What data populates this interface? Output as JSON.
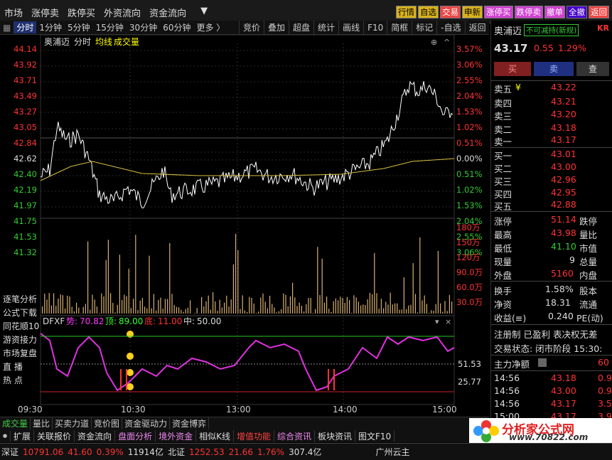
{
  "top": {
    "menus": [
      "市场",
      "涨停卖",
      "跌停买",
      "外资流向",
      "资金流向"
    ],
    "buttons": [
      "行情",
      "自选",
      "交易",
      "申新",
      "涨停买",
      "跌停卖",
      "撤单",
      "全撤",
      "返回"
    ]
  },
  "tabs": [
    "分时",
    "1分钟",
    "5分钟",
    "15分钟",
    "30分钟",
    "60分钟",
    "更多 〉"
  ],
  "tools": [
    "竞价",
    "叠加",
    "超盘",
    "统计",
    "画线",
    "F10",
    "简框",
    "标记",
    "-自选",
    "返回"
  ],
  "chart": {
    "stock_name": "奥浦迈",
    "labels": [
      "分时",
      "均线",
      "成交量"
    ],
    "left_prices": [
      "44.14",
      "43.92",
      "43.71",
      "43.49",
      "43.27",
      "43.05",
      "42.84",
      "42.62",
      "42.40",
      "42.19",
      "41.97",
      "41.75",
      "41.53",
      "41.32"
    ],
    "right_pcts": [
      "3.57%",
      "3.06%",
      "2.55%",
      "2.04%",
      "1.53%",
      "1.02%",
      "0.51%",
      "0.00%",
      "0.51%",
      "1.02%",
      "1.53%",
      "2.04%",
      "2.55%",
      "3.06%"
    ],
    "vol_labels": [
      "180万",
      "150万",
      "120万",
      "90.0万",
      "60.0万",
      "30.0万"
    ],
    "dfxf": {
      "name": "DFXF",
      "shi_label": "势:",
      "shi": "70.82",
      "ding_label": "顶:",
      "ding": "89.00",
      "di_label": "底:",
      "di": "11.00",
      "zhong_label": "中:",
      "zhong": "50.00"
    },
    "dfxf_levels": [
      "51.53",
      "25.77"
    ],
    "times": [
      "09:30",
      "10:30",
      "13:00",
      "14:00",
      "15:00"
    ]
  },
  "chart_data": {
    "type": "line",
    "x": [
      "09:30",
      "10:30",
      "13:00",
      "14:00",
      "15:00"
    ],
    "ylim": [
      41.32,
      44.14
    ],
    "series": []
  },
  "side": [
    "逐笔分析",
    "公式下载",
    "同花顺10",
    "游资接力",
    "市场复盘",
    "直  播",
    "热  点"
  ],
  "bottomtabs": [
    "成交量",
    "量比",
    "买卖力道",
    "竞价图",
    "资金驱动力",
    "资金博弈"
  ],
  "bar2": [
    "扩展",
    "关联报价",
    "资金流向",
    "盘面分析",
    "境外资金",
    "相似K线",
    "增值功能",
    "综合资讯",
    "板块资讯",
    "图文F10"
  ],
  "status": {
    "sz_label": "深证",
    "sz_val": "10791.06",
    "sz_chg": "41.60",
    "sz_pct": "0.39%",
    "sz_amt": "11914亿",
    "bz_label": "北证",
    "bz_val": "1252.53",
    "bz_chg": "21.66",
    "bz_pct": "1.76%",
    "bz_amt": "307.4亿",
    "right": "广州云主"
  },
  "right": {
    "name": "奥浦迈",
    "tag": "不可减持(新规)",
    "kr": "KR",
    "price": "43.17",
    "chg": "0.55",
    "pct": "1.29%",
    "buy_btn": "买",
    "sell_btn": "卖",
    "query_btn": "查",
    "asks": [
      {
        "k": "卖五",
        "v": "43.22"
      },
      {
        "k": "卖四",
        "v": "43.21"
      },
      {
        "k": "卖三",
        "v": "43.20"
      },
      {
        "k": "卖二",
        "v": "43.18"
      },
      {
        "k": "卖一",
        "v": "43.17"
      }
    ],
    "bids": [
      {
        "k": "买一",
        "v": "43.01"
      },
      {
        "k": "买二",
        "v": "43.00"
      },
      {
        "k": "买三",
        "v": "42.96"
      },
      {
        "k": "买四",
        "v": "42.95"
      },
      {
        "k": "买五",
        "v": "42.88"
      }
    ],
    "ask_mark": "¥",
    "stats": [
      {
        "k": "涨停",
        "v": "51.14",
        "k2": "跌停"
      },
      {
        "k": "最高",
        "v": "43.98",
        "k2": "量比"
      },
      {
        "k": "最低",
        "v": "41.10",
        "k2": "市值"
      },
      {
        "k": "现量",
        "v": "9",
        "k2": "总量"
      },
      {
        "k": "外盘",
        "v": "5160",
        "k2": "内盘"
      }
    ],
    "stats2": [
      {
        "k": "换手",
        "v": "1.58%",
        "k2": "股本"
      },
      {
        "k": "净资",
        "v": "18.31",
        "k2": "流通"
      },
      {
        "k": "收益(≡)",
        "v": "0.240",
        "k2": "PE(动)"
      }
    ],
    "flags": "注册制 已盈利 表决权无差",
    "trade_state": "交易状态: 闭市阶段 15:30:",
    "main_net": "主力净额",
    "main_net_val": "60",
    "ticks": [
      {
        "t": "14:56",
        "p": "43.18",
        "v": "0.9"
      },
      {
        "t": "14:56",
        "p": "43.00",
        "v": "0.9"
      },
      {
        "t": "14:56",
        "p": "43.17",
        "v": "3.5"
      },
      {
        "t": "15:00",
        "p": "43.17",
        "v": "3.9"
      }
    ]
  },
  "logo": {
    "name": "分析家公式网",
    "url": "www.70822.com"
  },
  "watermark": "分析家公式网 www.70822.com"
}
